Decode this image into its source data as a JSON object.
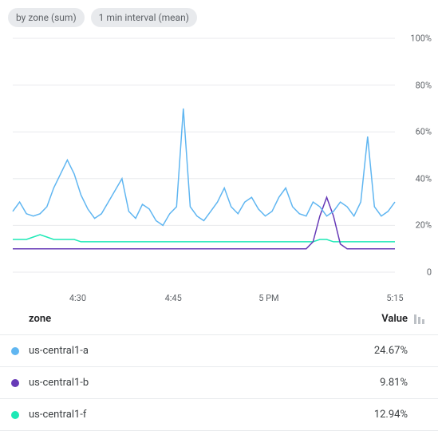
{
  "chips": [
    "by zone (sum)",
    "1 min interval (mean)"
  ],
  "chart_data": {
    "type": "line",
    "ylabel": "",
    "xlabel": "",
    "ylim": [
      0,
      100
    ],
    "y_ticks": [
      0,
      20,
      40,
      60,
      80,
      100
    ],
    "y_tick_labels": [
      "0",
      "20%",
      "40%",
      "60%",
      "80%",
      "100%"
    ],
    "x_ticks": [
      0.17,
      0.42,
      0.67,
      1.0
    ],
    "x_tick_labels": [
      "4:30",
      "4:45",
      "5 PM",
      "5:15"
    ],
    "series": [
      {
        "name": "us-central1-a",
        "color": "#60b6f1",
        "values": [
          26,
          30,
          25,
          24,
          25,
          28,
          36,
          42,
          48,
          42,
          33,
          27,
          23,
          25,
          30,
          35,
          40,
          26,
          23,
          29,
          27,
          22,
          20,
          25,
          28,
          70,
          28,
          24,
          22,
          26,
          30,
          36,
          28,
          25,
          30,
          32,
          27,
          24,
          26,
          32,
          36,
          28,
          25,
          24,
          30,
          28,
          24,
          26,
          30,
          28,
          24,
          30,
          58,
          28,
          24,
          26,
          30
        ]
      },
      {
        "name": "us-central1-b",
        "color": "#673ab7",
        "values": [
          10,
          10,
          10,
          10,
          10,
          10,
          10,
          10,
          10,
          10,
          10,
          10,
          10,
          10,
          10,
          10,
          10,
          10,
          10,
          10,
          10,
          10,
          10,
          10,
          10,
          10,
          10,
          10,
          10,
          10,
          10,
          10,
          10,
          10,
          10,
          10,
          10,
          10,
          10,
          10,
          10,
          10,
          10,
          10,
          13,
          24,
          32,
          24,
          12,
          10,
          10,
          10,
          10,
          10,
          10,
          10,
          10
        ]
      },
      {
        "name": "us-central1-f",
        "color": "#1de9b6",
        "values": [
          14,
          14,
          14,
          15,
          16,
          15,
          14,
          14,
          14,
          14,
          13,
          13,
          13,
          13,
          13,
          13,
          13,
          13,
          13,
          13,
          13,
          13,
          13,
          13,
          13,
          13,
          13,
          13,
          13,
          13,
          13,
          13,
          13,
          13,
          13,
          13,
          13,
          13,
          13,
          13,
          13,
          13,
          13,
          13,
          13,
          14,
          14,
          13,
          13,
          13,
          13,
          13,
          13,
          13,
          13,
          13,
          13
        ]
      }
    ]
  },
  "table": {
    "header_zone": "zone",
    "header_value": "Value",
    "rows": [
      {
        "color": "#60b6f1",
        "zone": "us-central1-a",
        "value": "24.67%"
      },
      {
        "color": "#673ab7",
        "zone": "us-central1-b",
        "value": "9.81%"
      },
      {
        "color": "#1de9b6",
        "zone": "us-central1-f",
        "value": "12.94%"
      }
    ]
  }
}
